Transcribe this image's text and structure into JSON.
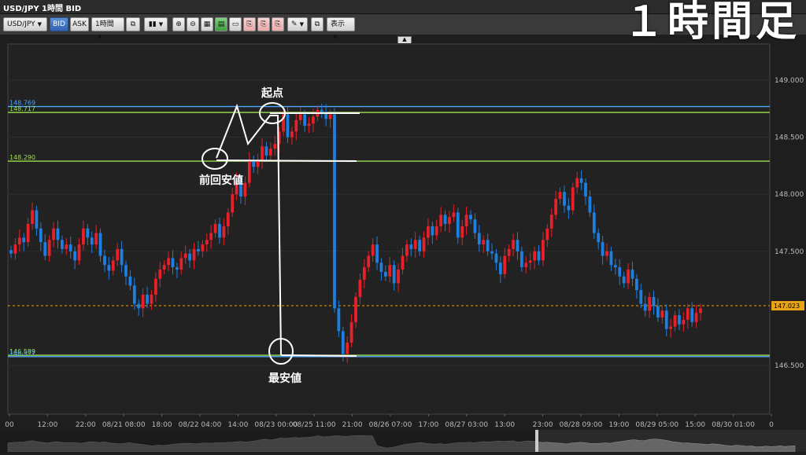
{
  "window": {
    "title": "USD/JPY 1時間 BID"
  },
  "overlay_label": "１時間足",
  "toolbar": {
    "symbol": "USD/JPY",
    "bid_label": "BID",
    "ask_label": "ASK",
    "timeframe": "1時間",
    "display_label": "表示"
  },
  "annotations": {
    "start_point": "起点",
    "previous_low": "前回安値",
    "lowest": "最安値"
  },
  "chart_data": {
    "type": "candlestick",
    "ylim": [
      146.25,
      149.2
    ],
    "yticks": [
      149.0,
      148.5,
      148.0,
      147.5,
      146.5
    ],
    "xtick_labels": [
      "00",
      "12:00",
      "22:00",
      "08/21 08:00",
      "18:00",
      "08/22 04:00",
      "14:00",
      "08/23 00:00",
      "08/25 11:00",
      "21:00",
      "08/26 07:00",
      "17:00",
      "08/27 03:00",
      "13:00",
      "23:00",
      "08/28 09:00",
      "19:00",
      "08/29 05:00",
      "15:00",
      "08/30 01:00",
      "0"
    ],
    "hlines": [
      {
        "price": 148.769,
        "label": "148.769",
        "color": "#4da6ff"
      },
      {
        "price": 148.717,
        "label": "148.717",
        "color": "#9be34d"
      },
      {
        "price": 148.29,
        "label": "148.290",
        "color": "#9be34d"
      },
      {
        "price": 146.589,
        "label": "146.589",
        "color": "#9be34d"
      },
      {
        "price": 146.577,
        "label": "146.577",
        "color": "#4da6ff"
      }
    ],
    "current_price": {
      "value": 147.023,
      "label": "147.023",
      "color": "#e8a317"
    },
    "colors": {
      "up": "#e8202a",
      "down": "#1e7fe0",
      "background": "#1e1e1e"
    },
    "closes": [
      147.48,
      147.56,
      147.62,
      147.58,
      147.74,
      147.86,
      147.7,
      147.58,
      147.46,
      147.6,
      147.7,
      147.6,
      147.52,
      147.56,
      147.5,
      147.42,
      147.56,
      147.7,
      147.62,
      147.56,
      147.66,
      147.46,
      147.38,
      147.33,
      147.42,
      147.52,
      147.38,
      147.28,
      147.2,
      147.04,
      147.0,
      147.12,
      147.04,
      147.12,
      147.26,
      147.34,
      147.38,
      147.44,
      147.36,
      147.34,
      147.44,
      147.48,
      147.42,
      147.52,
      147.5,
      147.56,
      147.6,
      147.66,
      147.74,
      147.62,
      147.72,
      147.84,
      148.0,
      148.12,
      147.98,
      148.1,
      148.3,
      148.24,
      148.3,
      148.42,
      148.34,
      148.4,
      148.44,
      148.55,
      148.7,
      148.5,
      148.55,
      148.65,
      148.7,
      148.6,
      148.62,
      148.68,
      148.74,
      148.72,
      148.66,
      148.7,
      147.0,
      146.8,
      146.6,
      146.7,
      146.88,
      147.1,
      147.25,
      147.36,
      147.46,
      147.56,
      147.4,
      147.32,
      147.28,
      147.38,
      147.22,
      147.34,
      147.46,
      147.56,
      147.52,
      147.6,
      147.5,
      147.62,
      147.72,
      147.64,
      147.72,
      147.82,
      147.74,
      147.8,
      147.84,
      147.62,
      147.72,
      147.82,
      147.78,
      147.66,
      147.56,
      147.6,
      147.5,
      147.48,
      147.4,
      147.3,
      147.46,
      147.52,
      147.6,
      147.5,
      147.36,
      147.4,
      147.42,
      147.5,
      147.42,
      147.6,
      147.7,
      147.82,
      147.96,
      148.02,
      147.9,
      147.86,
      148.06,
      148.14,
      148.1,
      147.98,
      147.84,
      147.66,
      147.58,
      147.46,
      147.5,
      147.38,
      147.36,
      147.28,
      147.22,
      147.34,
      147.26,
      147.16,
      147.04,
      146.98,
      147.1,
      147.02,
      146.92,
      146.98,
      146.82,
      146.84,
      146.94,
      146.86,
      146.9,
      147.0,
      146.88,
      146.96,
      147.0
    ]
  }
}
